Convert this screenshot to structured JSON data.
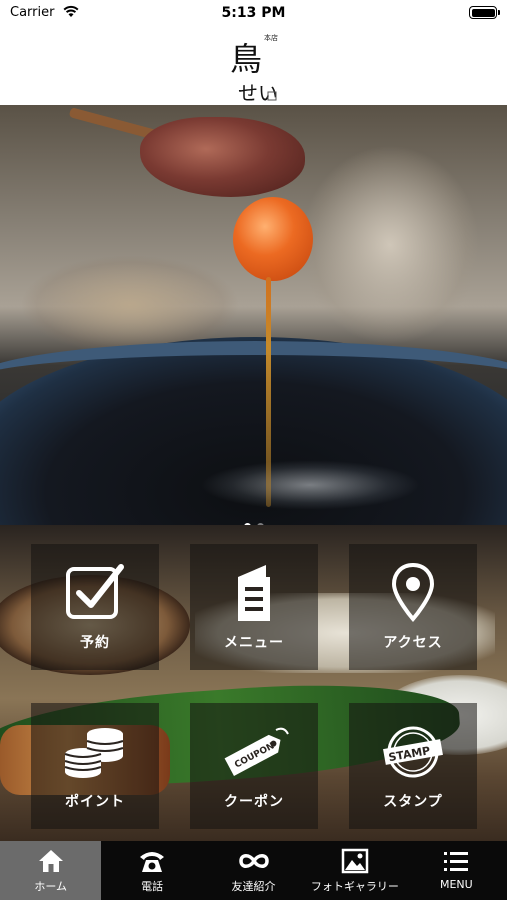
{
  "status_bar": {
    "carrier": "Carrier",
    "time": "5:13 PM"
  },
  "header": {
    "logo_text": "鳥せい",
    "logo_small": "本店"
  },
  "hero": {
    "slide_count": 2,
    "active_slide": 0
  },
  "menu": {
    "items": [
      {
        "label": "予約",
        "icon": "checkbox-icon"
      },
      {
        "label": "メニュー",
        "icon": "menu-book-icon"
      },
      {
        "label": "アクセス",
        "icon": "location-pin-icon"
      },
      {
        "label": "ポイント",
        "icon": "coins-icon"
      },
      {
        "label": "クーポン",
        "icon": "coupon-icon",
        "icon_text": "COUPON"
      },
      {
        "label": "スタンプ",
        "icon": "stamp-icon",
        "icon_text": "STAMP"
      }
    ]
  },
  "tabbar": {
    "items": [
      {
        "label": "ホーム",
        "icon": "home-icon",
        "active": true
      },
      {
        "label": "電話",
        "icon": "phone-icon"
      },
      {
        "label": "友達紹介",
        "icon": "infinity-icon"
      },
      {
        "label": "フォトギャラリー",
        "icon": "photo-gallery-icon"
      },
      {
        "label": "MENU",
        "icon": "hamburger-icon"
      }
    ]
  }
}
